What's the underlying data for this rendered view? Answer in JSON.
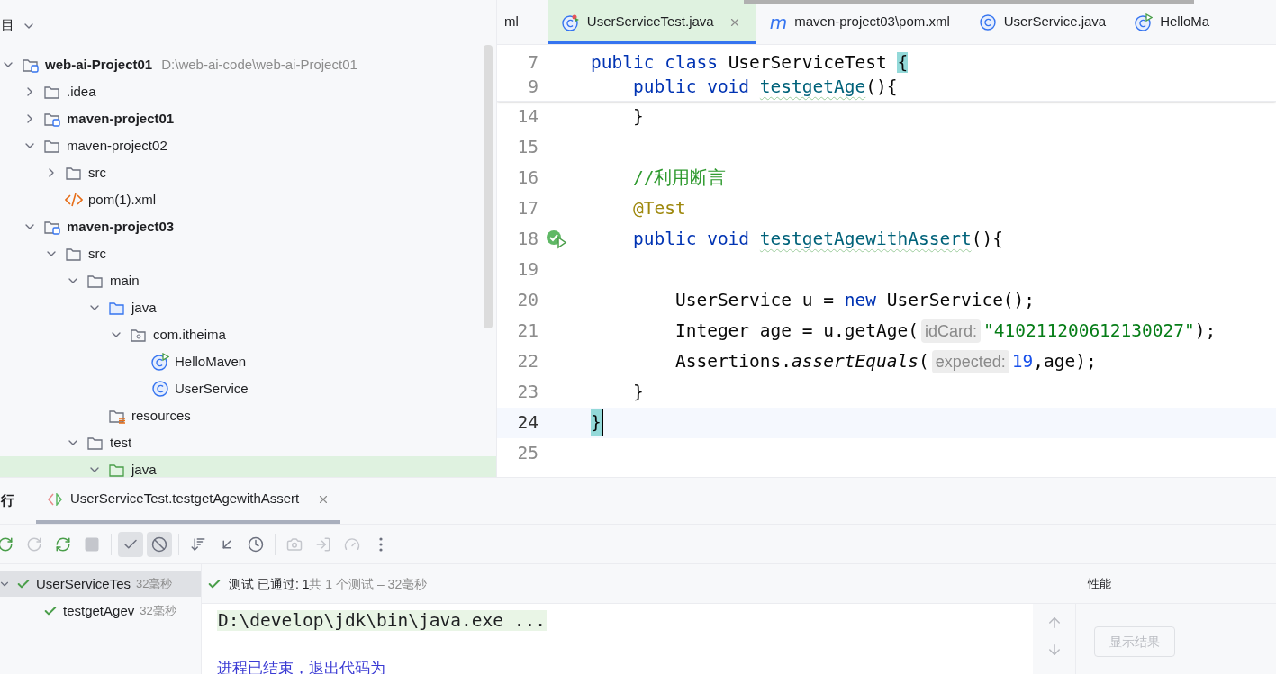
{
  "project_panel": {
    "title": "目",
    "tree": [
      {
        "label": "web-ai-Project01",
        "path": "D:\\web-ai-code\\web-ai-Project01",
        "kind": "module",
        "expanded": true,
        "selected": false,
        "children": [
          {
            "label": ".idea",
            "kind": "folder",
            "expanded": false,
            "selected": false
          },
          {
            "label": "maven-project01",
            "kind": "module",
            "expanded": false,
            "selected": false
          },
          {
            "label": "maven-project02",
            "kind": "folder",
            "expanded": true,
            "selected": false,
            "children": [
              {
                "label": "src",
                "kind": "folder",
                "expanded": false,
                "selected": false
              },
              {
                "label": "pom(1).xml",
                "kind": "xml",
                "selected": false
              }
            ]
          },
          {
            "label": "maven-project03",
            "kind": "module",
            "expanded": true,
            "selected": false,
            "children": [
              {
                "label": "src",
                "kind": "folder",
                "expanded": true,
                "selected": false,
                "children": [
                  {
                    "label": "main",
                    "kind": "folder",
                    "expanded": true,
                    "selected": false,
                    "children": [
                      {
                        "label": "java",
                        "kind": "source-folder",
                        "expanded": true,
                        "selected": false,
                        "children": [
                          {
                            "label": "com.itheima",
                            "kind": "package",
                            "expanded": true,
                            "selected": false,
                            "children": [
                              {
                                "label": "HelloMaven",
                                "kind": "runnable-class",
                                "selected": false
                              },
                              {
                                "label": "UserService",
                                "kind": "class",
                                "selected": false
                              }
                            ]
                          }
                        ]
                      },
                      {
                        "label": "resources",
                        "kind": "resources",
                        "selected": false
                      }
                    ]
                  },
                  {
                    "label": "test",
                    "kind": "folder",
                    "expanded": true,
                    "selected": false,
                    "children": [
                      {
                        "label": "java",
                        "kind": "test-folder",
                        "expanded": true,
                        "selected": true
                      }
                    ]
                  }
                ]
              }
            ]
          }
        ]
      }
    ]
  },
  "editor_tabs": [
    {
      "label": "ml",
      "kind": "partial",
      "selected": false
    },
    {
      "label": "UserServiceTest.java",
      "kind": "test-class",
      "selected": true,
      "closable": true
    },
    {
      "label": "maven-project03\\pom.xml",
      "kind": "maven",
      "icon_text": "m",
      "selected": false
    },
    {
      "label": "UserService.java",
      "kind": "class",
      "selected": false
    },
    {
      "label": "HelloMa",
      "kind": "runnable-class",
      "selected": false
    }
  ],
  "sticky_lines": [
    {
      "number": "7",
      "tokens": [
        {
          "kind": "keyword",
          "text": "public class "
        },
        {
          "kind": "plain",
          "text": "UserServiceTest "
        },
        {
          "kind": "brace",
          "text": "{"
        }
      ]
    },
    {
      "number": "9",
      "tokens": [
        {
          "kind": "keyword",
          "text": "    public void "
        },
        {
          "kind": "method",
          "text": "testgetAge"
        },
        {
          "kind": "plain",
          "text": "(){"
        }
      ]
    }
  ],
  "code_lines": [
    {
      "number": "14",
      "current": false,
      "gutter_mark": false,
      "tokens": [
        {
          "kind": "plain",
          "text": "    }"
        }
      ]
    },
    {
      "number": "15",
      "current": false,
      "gutter_mark": false
    },
    {
      "number": "16",
      "current": false,
      "gutter_mark": false,
      "tokens": [
        {
          "kind": "comment",
          "text": "    //利用断言"
        }
      ]
    },
    {
      "number": "17",
      "current": false,
      "gutter_mark": false,
      "tokens": [
        {
          "kind": "annotation",
          "text": "    @Test"
        }
      ]
    },
    {
      "number": "18",
      "current": false,
      "gutter_mark": true,
      "tokens": [
        {
          "kind": "keyword",
          "text": "    public void "
        },
        {
          "kind": "method",
          "text": "testgetAgewithAssert"
        },
        {
          "kind": "plain",
          "text": "(){"
        }
      ]
    },
    {
      "number": "19",
      "current": false,
      "gutter_mark": false
    },
    {
      "number": "20",
      "current": false,
      "gutter_mark": false,
      "tokens": [
        {
          "kind": "plain",
          "text": "        UserService u = "
        },
        {
          "kind": "keyword",
          "text": "new "
        },
        {
          "kind": "plain",
          "text": "UserService();"
        }
      ]
    },
    {
      "number": "21",
      "current": false,
      "gutter_mark": false,
      "tokens": [
        {
          "kind": "plain",
          "text": "        Integer age = u.getAge("
        },
        {
          "kind": "hint",
          "text": "idCard:"
        },
        {
          "kind": "string",
          "text": "\"410211200612130027\""
        },
        {
          "kind": "plain",
          "text": ");"
        }
      ]
    },
    {
      "number": "22",
      "current": false,
      "gutter_mark": false,
      "tokens": [
        {
          "kind": "plain",
          "text": "        Assertions."
        },
        {
          "kind": "static",
          "text": "assertEquals"
        },
        {
          "kind": "plain",
          "text": "("
        },
        {
          "kind": "hint",
          "text": "expected:"
        },
        {
          "kind": "number",
          "text": "19"
        },
        {
          "kind": "plain",
          "text": ",age);"
        }
      ]
    },
    {
      "number": "23",
      "current": false,
      "gutter_mark": false,
      "tokens": [
        {
          "kind": "plain",
          "text": "    }"
        }
      ]
    },
    {
      "number": "24",
      "current": true,
      "gutter_mark": false,
      "tokens": [
        {
          "kind": "caret-brace",
          "text": "}"
        }
      ]
    },
    {
      "number": "25",
      "current": false,
      "gutter_mark": false
    }
  ],
  "run_panel": {
    "title": "行",
    "tabs": [
      {
        "label": "UserServiceTest.testgetAgewithAssert",
        "selected": true
      }
    ],
    "toolbar": [
      {
        "kind": "rerun",
        "disabled": false,
        "on": false
      },
      {
        "kind": "rerun-failed",
        "disabled": true,
        "on": false
      },
      {
        "kind": "toggle-auto-test",
        "disabled": false,
        "on": false
      },
      {
        "kind": "stop",
        "disabled": true,
        "on": false
      },
      {
        "kind": "show-passed",
        "disabled": false,
        "on": true
      },
      {
        "kind": "show-ignored",
        "disabled": false,
        "on": true
      },
      {
        "kind": "sort",
        "disabled": false,
        "on": false
      },
      {
        "kind": "collapse",
        "disabled": false,
        "on": false
      },
      {
        "kind": "history",
        "disabled": false,
        "on": false
      },
      {
        "kind": "camera",
        "disabled": true,
        "on": false
      },
      {
        "kind": "import",
        "disabled": true,
        "on": false
      },
      {
        "kind": "gauge",
        "disabled": true,
        "on": false
      },
      {
        "kind": "more",
        "disabled": false,
        "on": false
      }
    ],
    "tests": [
      {
        "label": "UserServiceTes",
        "time": "32毫秒",
        "passed": true,
        "selected": true,
        "children": [
          {
            "label": "testgetAgev",
            "time": "32毫秒",
            "passed": true,
            "selected": false
          }
        ]
      }
    ],
    "status": {
      "passed": true,
      "summary": "测试 已通过: 1",
      "detail": "共 1 个测试 – 32毫秒"
    },
    "console": [
      {
        "kind": "command",
        "text": "D:\\develop\\jdk\\bin\\java.exe ..."
      },
      {
        "kind": "system",
        "text": "进程已结束，退出代码为"
      }
    ],
    "side": {
      "title": "性能",
      "button": {
        "label": "显示结果",
        "disabled": true
      }
    }
  }
}
